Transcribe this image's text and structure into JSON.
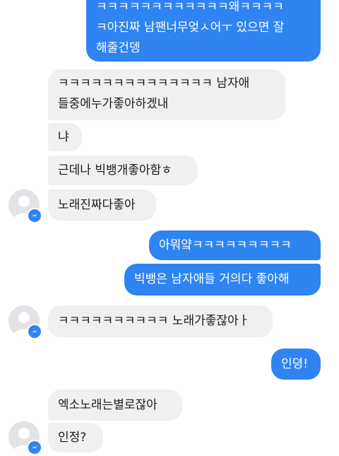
{
  "colors": {
    "sent_bubble": "#2f84f2",
    "received_bubble": "#f0f0f0",
    "badge": "#2f84f2"
  },
  "messages": [
    {
      "side": "sent",
      "lines": [
        "ㅋㅋㅋㅋㅋㅋㅋㅋㅋㅋㅋㅋ왜ㅋㅋㅋㅋ",
        "ㅋ아진짜 남팬너무엊ㅅ어ㅜ 있으면 잘",
        "해줄건뎅"
      ]
    },
    {
      "side": "received",
      "lines": [
        "ㅋㅋㅋㅋㅋㅋㅋㅋㅋㅋㅋㅋㅋㅋ 남자애",
        "들중에누가좋아하겠내"
      ]
    },
    {
      "side": "received",
      "text": "냐"
    },
    {
      "side": "received",
      "text": "근데나 빅뱅개좋아함ㅎ"
    },
    {
      "side": "received",
      "text": "노래진짜다좋아"
    },
    {
      "side": "sent",
      "text": "아뭐얔ㅋㅋㅋㅋㅋㅋㅋㅋㅋ"
    },
    {
      "side": "sent",
      "text": "빅뱅은 남자애들 거의다 좋아해"
    },
    {
      "side": "received",
      "text": "ㅋㅋㅋㅋㅋㅋㅋㅋㅋㅋ 노래가좋잖아ㅏ"
    },
    {
      "side": "sent",
      "text": "인뎡!"
    },
    {
      "side": "received",
      "text": "엑소노래는별로잖아"
    },
    {
      "side": "received",
      "text": "인정?"
    }
  ],
  "avatar": {
    "icon": "default-profile-icon",
    "badge_icon": "messenger-badge-icon"
  }
}
